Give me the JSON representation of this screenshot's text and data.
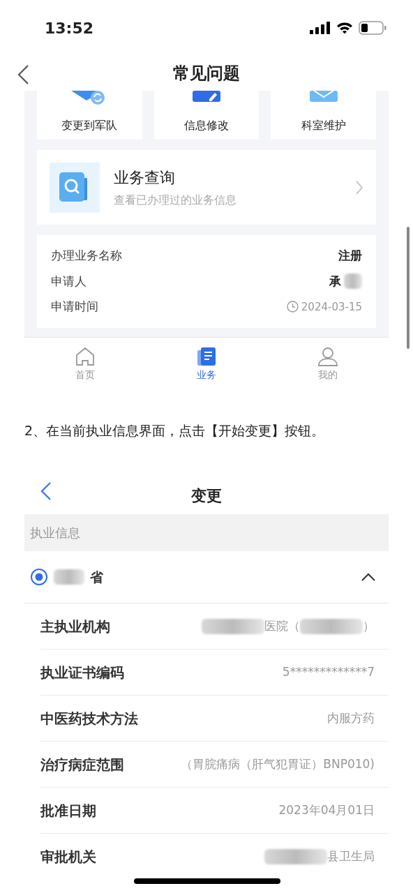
{
  "status_bar": {
    "time": "13:52"
  },
  "header": {
    "title": "常见问题"
  },
  "screenshot_1": {
    "shortcuts": [
      {
        "label": "变更到军队"
      },
      {
        "label": "信息修改"
      },
      {
        "label": "科室维护"
      }
    ],
    "query_card": {
      "title": "业务查询",
      "subtitle": "查看已办理过的业务信息"
    },
    "record": [
      {
        "label": "办理业务名称",
        "kind": "plain",
        "parts": [
          {
            "kind": "text",
            "text": "注册"
          }
        ]
      },
      {
        "label": "申请人",
        "kind": "plain",
        "parts": [
          {
            "kind": "text",
            "text": "承"
          },
          {
            "kind": "redacted"
          }
        ]
      },
      {
        "label": "申请时间",
        "kind": "time",
        "parts": [
          {
            "kind": "text",
            "text": "2024-03-15"
          }
        ]
      }
    ],
    "tabs": [
      {
        "label": "首页",
        "kind": "home",
        "selected": false
      },
      {
        "label": "业务",
        "kind": "business",
        "selected": true
      },
      {
        "label": "我的",
        "kind": "profile",
        "selected": false
      }
    ]
  },
  "instruction": "2、在当前执业信息界面，点击【开始变更】按钮。",
  "screenshot_2": {
    "title": "变更",
    "section": "执业信息",
    "province": {
      "parts": [
        {
          "kind": "redacted"
        },
        {
          "kind": "text",
          "text": "省"
        }
      ],
      "selected": true,
      "expanded": true
    },
    "rows": [
      {
        "label": "主执业机构",
        "parts": [
          {
            "kind": "redacted"
          },
          {
            "kind": "text",
            "text": "医院（"
          },
          {
            "kind": "redacted"
          },
          {
            "kind": "text",
            "text": "）"
          }
        ]
      },
      {
        "label": "执业证书编码",
        "parts": [
          {
            "kind": "text",
            "text": "5*************7"
          }
        ]
      },
      {
        "label": "中医药技术方法",
        "parts": [
          {
            "kind": "text",
            "text": "内服方药"
          }
        ]
      },
      {
        "label": "治疗病症范围",
        "parts": [
          {
            "kind": "text",
            "text": "（胃脘痛病（肝气犯胃证）BNP010)"
          }
        ]
      },
      {
        "label": "批准日期",
        "parts": [
          {
            "kind": "text",
            "text": "2023年04月01日"
          }
        ]
      },
      {
        "label": "审批机关",
        "parts": [
          {
            "kind": "redacted"
          },
          {
            "kind": "text",
            "text": "县卫生局"
          }
        ]
      }
    ]
  }
}
